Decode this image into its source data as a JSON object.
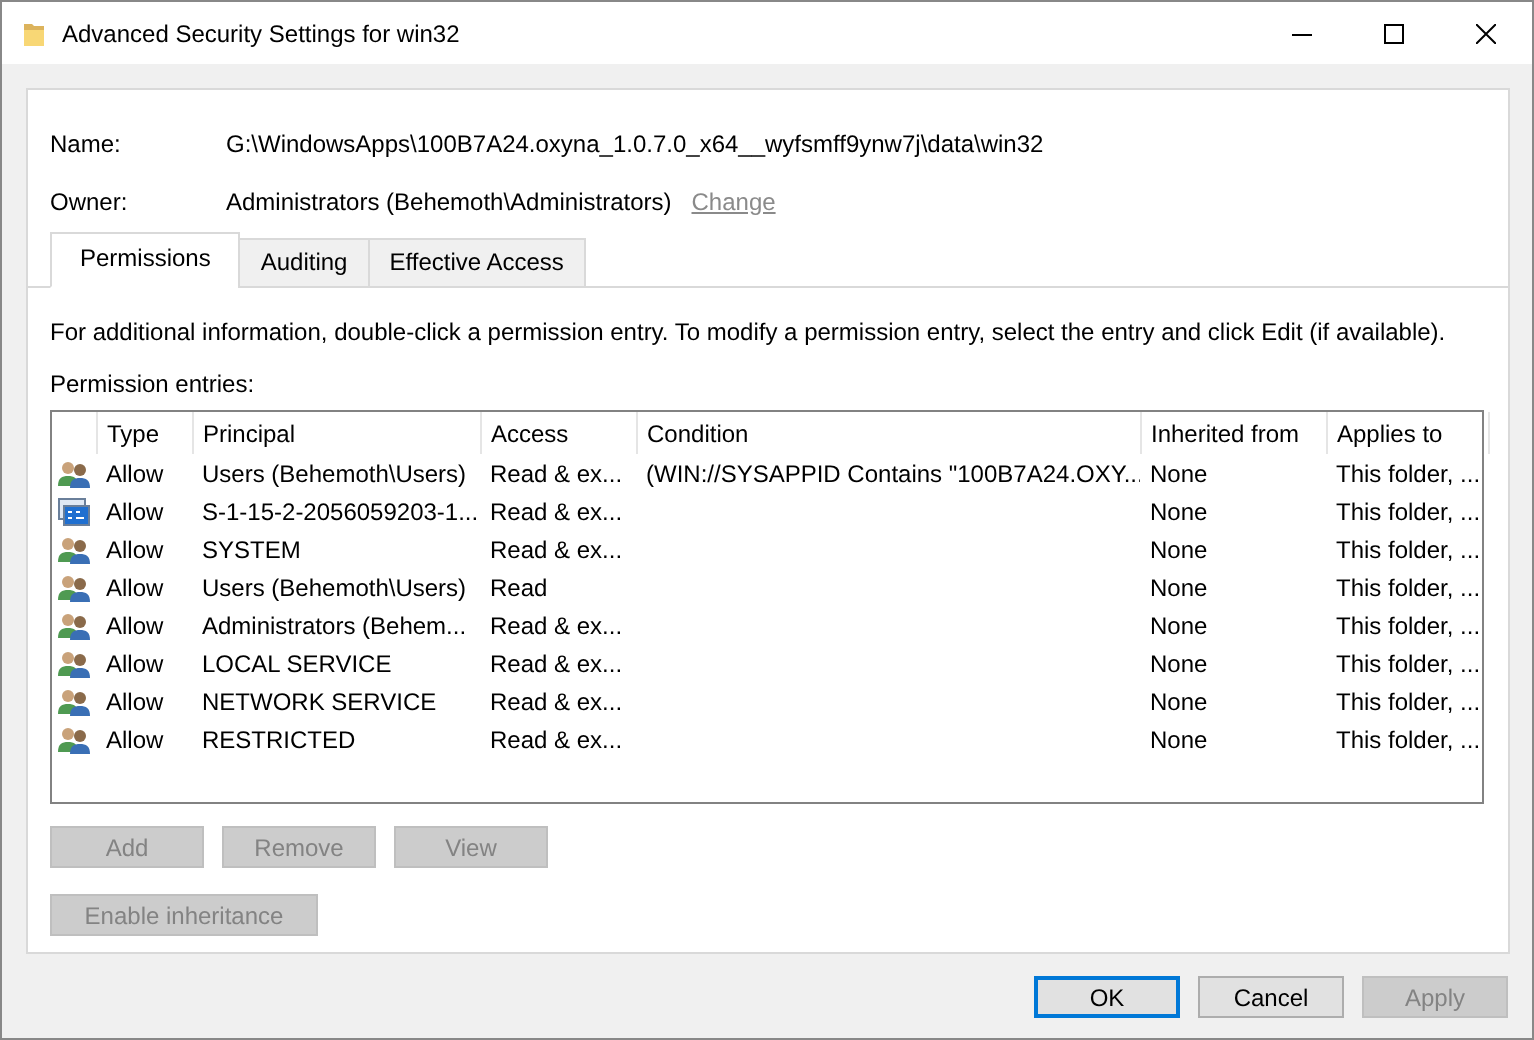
{
  "window": {
    "title": "Advanced Security Settings for win32"
  },
  "name": {
    "label": "Name:",
    "value": "G:\\WindowsApps\\100B7A24.oxyna_1.0.7.0_x64__wyfsmff9ynw7j\\data\\win32"
  },
  "owner": {
    "label": "Owner:",
    "value": "Administrators (Behemoth\\Administrators)",
    "link": "Change",
    "disabled": true
  },
  "tabs": [
    {
      "label": "Permissions",
      "selected": true
    },
    {
      "label": "Auditing",
      "selected": false
    },
    {
      "label": "Effective Access",
      "selected": false
    }
  ],
  "info": "For additional information, double-click a permission entry. To modify a permission entry, select the entry and click Edit (if available).",
  "entries_label": "Permission entries:",
  "table": {
    "columns": [
      "Type",
      "Principal",
      "Access",
      "Condition",
      "Inherited from",
      "Applies to"
    ],
    "rows": [
      {
        "kind": "group",
        "cells": [
          "Allow",
          "Users (Behemoth\\Users)",
          "Read & ex...",
          "(WIN://SYSAPPID Contains \"100B7A24.OXY...",
          "None",
          "This folder, ..."
        ]
      },
      {
        "kind": "app",
        "cells": [
          "Allow",
          "S-1-15-2-2056059203-1...",
          "Read & ex...",
          "",
          "None",
          "This folder, ..."
        ]
      },
      {
        "kind": "group",
        "cells": [
          "Allow",
          "SYSTEM",
          "Read & ex...",
          "",
          "None",
          "This folder, ..."
        ]
      },
      {
        "kind": "group",
        "cells": [
          "Allow",
          "Users (Behemoth\\Users)",
          "Read",
          "",
          "None",
          "This folder, ..."
        ]
      },
      {
        "kind": "group",
        "cells": [
          "Allow",
          "Administrators (Behem...",
          "Read & ex...",
          "",
          "None",
          "This folder, ..."
        ]
      },
      {
        "kind": "group",
        "cells": [
          "Allow",
          "LOCAL SERVICE",
          "Read & ex...",
          "",
          "None",
          "This folder, ..."
        ]
      },
      {
        "kind": "group",
        "cells": [
          "Allow",
          "NETWORK SERVICE",
          "Read & ex...",
          "",
          "None",
          "This folder, ..."
        ]
      },
      {
        "kind": "group",
        "cells": [
          "Allow",
          "RESTRICTED",
          "Read & ex...",
          "",
          "None",
          "This folder, ..."
        ]
      }
    ]
  },
  "entry_buttons": [
    {
      "label": "Add",
      "disabled": true
    },
    {
      "label": "Remove",
      "disabled": true
    },
    {
      "label": "View",
      "disabled": true
    }
  ],
  "inheritance_button": {
    "label": "Enable inheritance",
    "disabled": true
  },
  "dialog_buttons": [
    {
      "label": "OK",
      "disabled": false,
      "default": true
    },
    {
      "label": "Cancel",
      "disabled": false,
      "default": false
    },
    {
      "label": "Apply",
      "disabled": true,
      "default": false
    }
  ]
}
